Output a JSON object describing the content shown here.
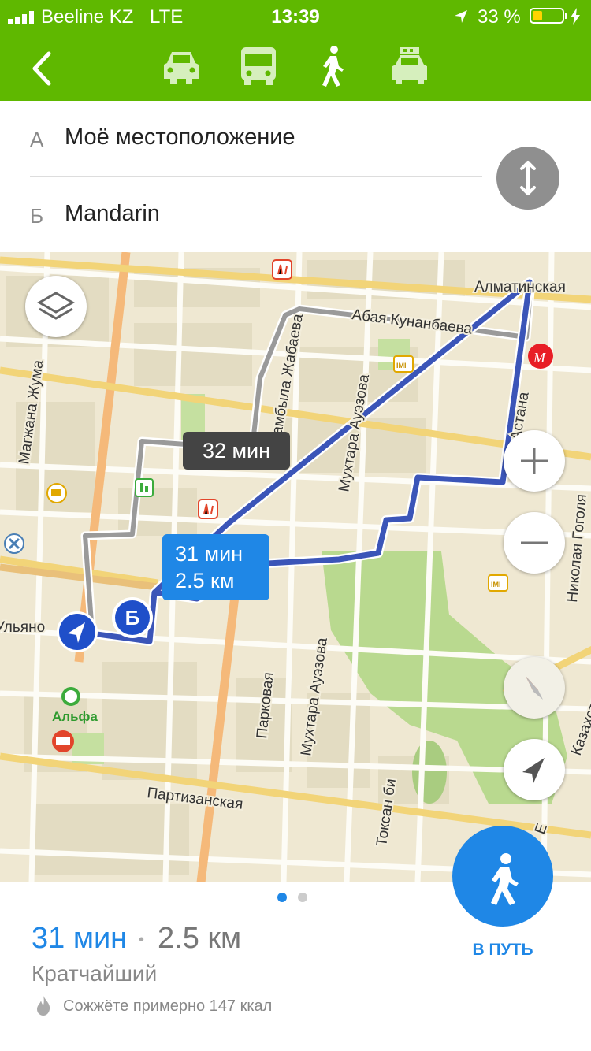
{
  "status_bar": {
    "carrier": "Beeline KZ",
    "network": "LTE",
    "time": "13:39",
    "battery_text": "33 %",
    "battery_level": 0.33
  },
  "transport_modes": [
    {
      "icon": "car-icon",
      "selected": false
    },
    {
      "icon": "bus-icon",
      "selected": false
    },
    {
      "icon": "pedestrian-icon",
      "selected": true
    },
    {
      "icon": "taxi-icon",
      "selected": false
    }
  ],
  "route": {
    "from_letter": "А",
    "from_value": "Моё местоположение",
    "to_letter": "Б",
    "to_value": "Mandarin"
  },
  "map": {
    "streets": [
      "Алматинская",
      "Абая Кунанбаева",
      "Жамбыла Жабаева",
      "Магжана Жума",
      "Мухтара Ауэзова",
      "Астана",
      "Николая Гоголя",
      "Ульяно",
      "Мухтара Ауэзова",
      "Парковая",
      "Партизанская",
      "Токсан би",
      "Казахстан",
      "Е"
    ],
    "poi_label": "Альфа",
    "alt_route_time": "32 мин",
    "main_route_time": "31 мин",
    "main_route_distance": "2.5 км",
    "destination_marker": "Б"
  },
  "summary": {
    "duration": "31 мин",
    "separator": "•",
    "distance": "2.5 км",
    "route_type": "Кратчайший",
    "calories": "Сожжёте примерно 147 ккал",
    "page_count": 2,
    "current_page": 1
  },
  "go_button": {
    "label": "В ПУТЬ"
  },
  "colors": {
    "header": "#5fb800",
    "accent": "#1f87e6",
    "route": "#3b55b8",
    "alt_route": "#9a9a9a",
    "park": "#b9d98f"
  }
}
